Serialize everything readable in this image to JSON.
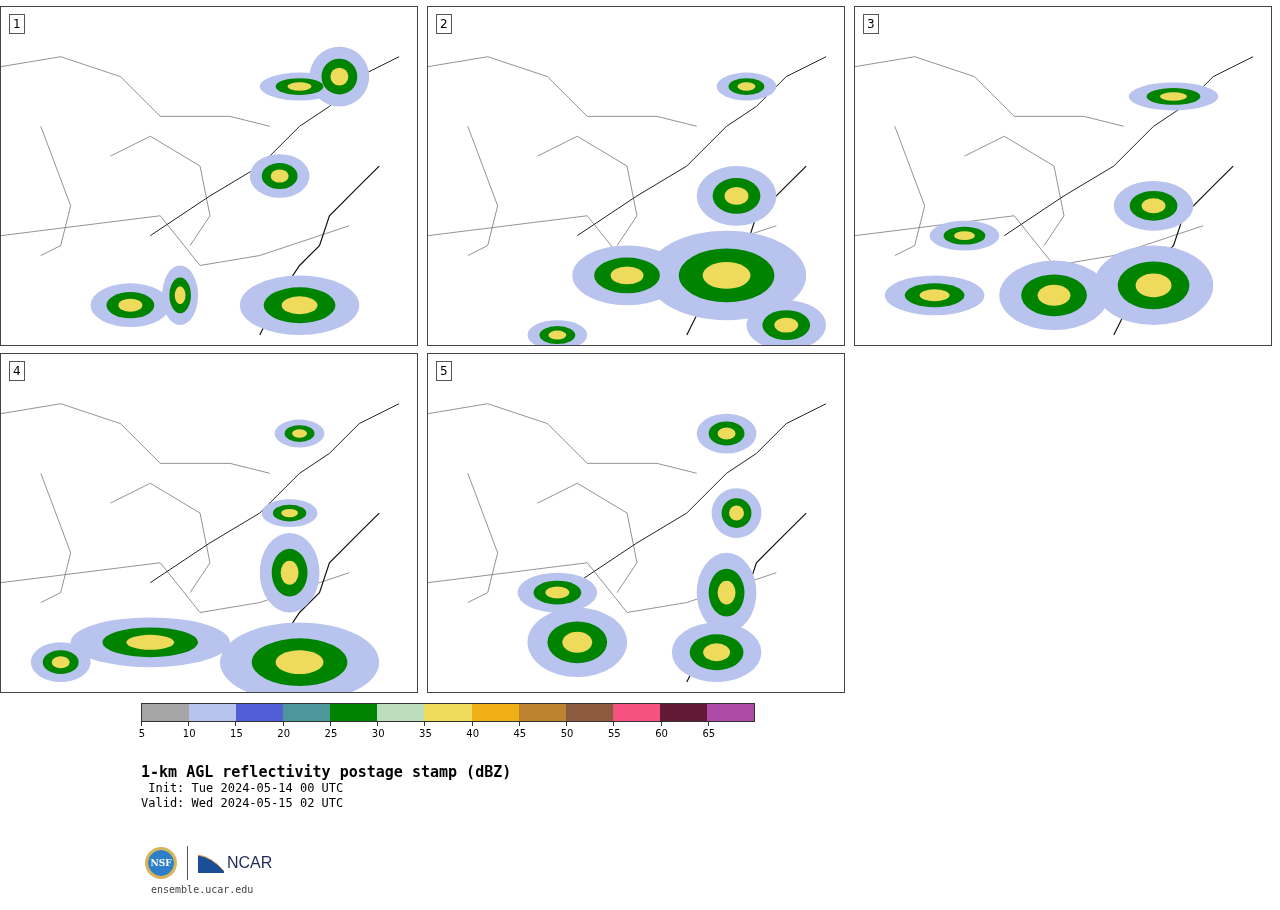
{
  "panels": [
    {
      "label": "1"
    },
    {
      "label": "2"
    },
    {
      "label": "3"
    },
    {
      "label": "4"
    },
    {
      "label": "5"
    }
  ],
  "colorbar": {
    "segments": [
      {
        "color": "#a5a5a5"
      },
      {
        "color": "#b8c3ee"
      },
      {
        "color": "#515ed8"
      },
      {
        "color": "#4d979b"
      },
      {
        "color": "#008400"
      },
      {
        "color": "#bddcbb"
      },
      {
        "color": "#eedb5c"
      },
      {
        "color": "#f0ae17"
      },
      {
        "color": "#bd8430"
      },
      {
        "color": "#8c5a3e"
      },
      {
        "color": "#f6527f"
      },
      {
        "color": "#611936"
      },
      {
        "color": "#ad4aa6"
      }
    ],
    "ticks": [
      "5",
      "10",
      "15",
      "20",
      "25",
      "30",
      "35",
      "40",
      "45",
      "50",
      "55",
      "60",
      "65"
    ]
  },
  "title": "1-km AGL reflectivity postage stamp (dBZ)",
  "init": " Init: Tue 2024-05-14 00 UTC",
  "valid": "Valid: Wed 2024-05-15 02 UTC",
  "logos": {
    "seal_text": "NSF",
    "brand_text": "NCAR"
  },
  "footer": "ensemble.ucar.edu"
}
